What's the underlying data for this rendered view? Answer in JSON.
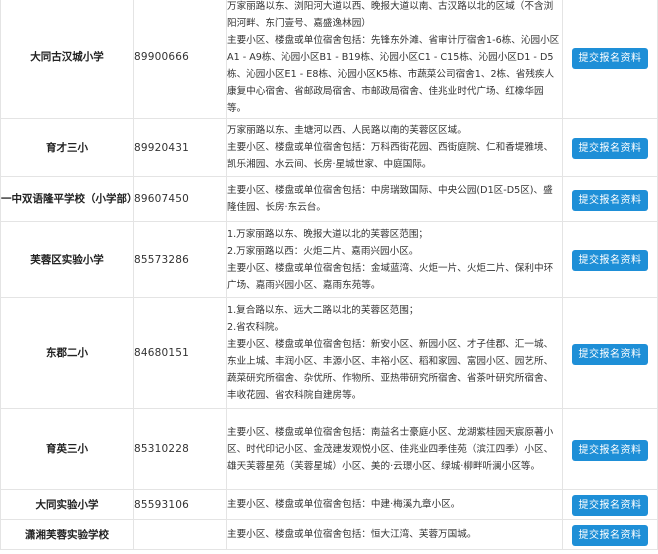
{
  "rows": [
    {
      "school": "大同古汉城小学",
      "phone": "89900666",
      "lines": [
        "万家丽路以东、浏阳河大道以西、晚报大道以南、古汉路以北的区域（不含浏阳河畔、东门壹号、嘉盛逸林园）",
        "主要小区、楼盘或单位宿舍包括：先锋东外滩、省审计厅宿舍1-6栋、沁园小区A1 - A9栋、沁园小区B1 - B19栋、沁园小区C1 - C15栋、沁园小区D1 - D5栋、沁园小区E1 - E8栋、沁园小区K5栋、市蔬菜公司宿舍1、2栋、省残疾人康复中心宿舍、省邮政局宿舍、市邮政局宿舍、佳兆业时代广场、红橡华园等。"
      ],
      "button": "提交报名资料"
    },
    {
      "school": "育才三小",
      "phone": "89920431",
      "lines": [
        "万家丽路以东、圭塘河以西、人民路以南的芙蓉区区域。",
        "主要小区、楼盘或单位宿舍包括：万科西街花园、西街庭院、仁和香堤雅境、凯乐湘园、水云间、长房·星城世家、中庭国际。"
      ],
      "button": "提交报名资料"
    },
    {
      "school": "一中双语隆平学校（小学部）",
      "phone": "89607450",
      "lines": [
        "主要小区、楼盘或单位宿舍包括：中房瑞致国际、中央公园(D1区-D5区)、盛隆佳园、长房·东云台。"
      ],
      "button": "提交报名资料"
    },
    {
      "school": "芙蓉区实验小学",
      "phone": "85573286",
      "lines": [
        "1.万家丽路以东、晚报大道以北的芙蓉区范围；",
        "2.万家丽路以西：火炬二片、嘉雨兴园小区。",
        "主要小区、楼盘或单位宿舍包括：金域蓝湾、火炬一片、火炬二片、保利中环广场、嘉雨兴园小区、嘉雨东苑等。"
      ],
      "button": "提交报名资料"
    },
    {
      "school": "东郡二小",
      "phone": "84680151",
      "lines": [
        "1.复合路以东、远大二路以北的芙蓉区范围；",
        "2.省农科院。",
        "主要小区、楼盘或单位宿舍包括：新安小区、新园小区、才子佳郡、汇一城、东业上城、丰润小区、丰源小区、丰裕小区、稻和家园、富园小区、园艺所、蔬菜研究所宿舍、杂优所、作物所、亚热带研究所宿舍、省茶叶研究所宿舍、丰收花园、省农科院自建房等。"
      ],
      "button": "提交报名资料"
    },
    {
      "school": "育英三小",
      "phone": "85310228",
      "lines": [
        "主要小区、楼盘或单位宿舍包括：南益名士豪庭小区、龙湖紫桂园天宸原著小区、时代印记小区、金茂建发观悦小区、佳兆业四季佳苑（滨江四季）小区、雄天芙蓉星苑（芙蓉星城）小区、美的·云璟小区、绿城·柳畔听澜小区等。"
      ],
      "button": "提交报名资料"
    },
    {
      "school": "大同实验小学",
      "phone": "85593106",
      "lines": [
        "主要小区、楼盘或单位宿舍包括：中建·梅溪九章小区。"
      ],
      "button": "提交报名资料"
    },
    {
      "school": "潇湘芙蓉实验学校",
      "phone": "",
      "lines": [
        "主要小区、楼盘或单位宿舍包括：恒大江湾、芙蓉万国城。"
      ],
      "button": "提交报名资料"
    }
  ]
}
